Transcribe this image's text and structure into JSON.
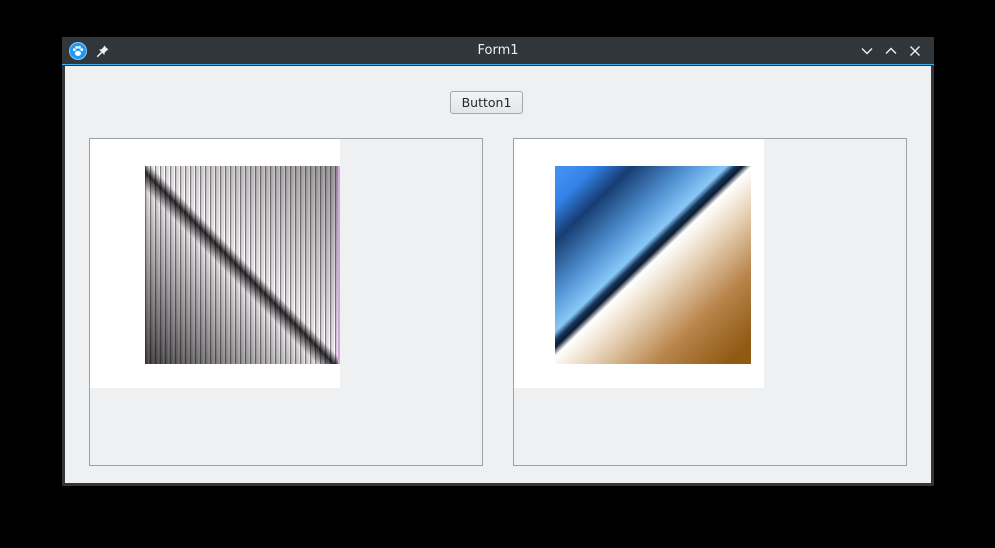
{
  "window": {
    "title": "Form1"
  },
  "titlebar": {
    "app_icon": "paw-icon",
    "pin_icon": "pin-icon",
    "minimize_icon": "chevron-down-icon",
    "maximize_icon": "chevron-up-icon",
    "close_icon": "close-icon"
  },
  "form": {
    "button_label": "Button1"
  },
  "colors": {
    "titlebar_bg": "#31363b",
    "accent": "#3daee9",
    "client_bg": "#eff0f1"
  }
}
